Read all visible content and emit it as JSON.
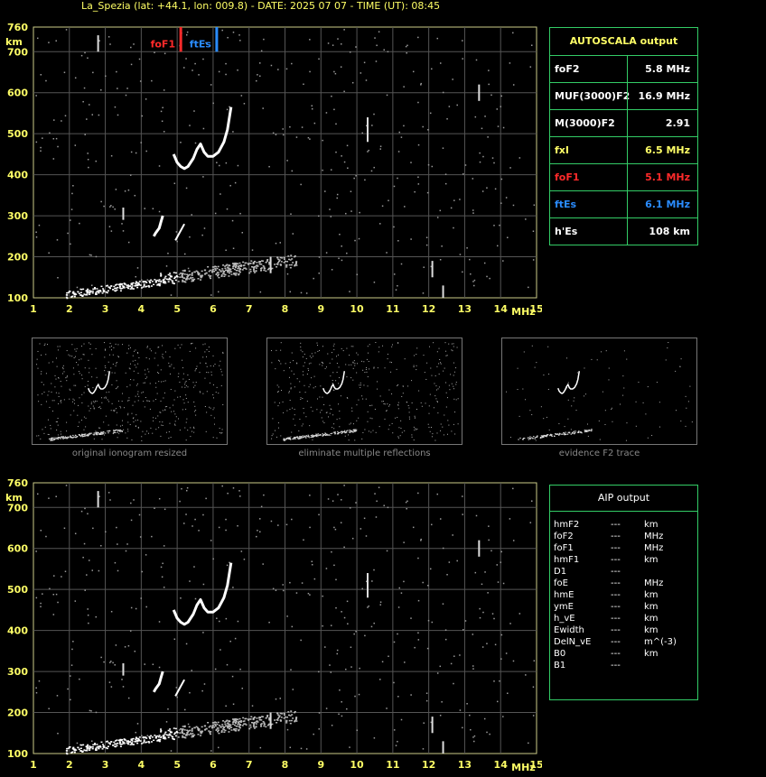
{
  "header": {
    "title": "La_Spezia (lat: +44.1, lon: 009.8) - DATE: 2025 07 07 - TIME (UT): 08:45"
  },
  "axes": {
    "y_unit": "km",
    "x_unit": "MHz",
    "y_ticks": [
      "760",
      "700",
      "600",
      "500",
      "400",
      "300",
      "200",
      "100"
    ],
    "x_ticks": [
      "1",
      "2",
      "3",
      "4",
      "5",
      "6",
      "7",
      "8",
      "9",
      "10",
      "11",
      "12",
      "13",
      "14",
      "15"
    ],
    "ylim": [
      100,
      760
    ],
    "xlim": [
      1,
      15
    ],
    "grid": true
  },
  "markers": [
    {
      "label": "foF1",
      "freq": 5.1,
      "color": "#ff2a2a"
    },
    {
      "label": "ftEs",
      "freq": 6.1,
      "color": "#2a8cff"
    }
  ],
  "autoscala": {
    "title": "AUTOSCALA output",
    "rows": [
      {
        "label": "foF2",
        "value": "5.8 MHz",
        "color": "#ffffff"
      },
      {
        "label": "MUF(3000)F2",
        "value": "16.9 MHz",
        "color": "#ffffff"
      },
      {
        "label": "M(3000)F2",
        "value": "2.91",
        "color": "#ffffff"
      },
      {
        "label": "fxI",
        "value": "6.5 MHz",
        "color": "#ffff66"
      },
      {
        "label": "foF1",
        "value": "5.1 MHz",
        "color": "#ff2a2a"
      },
      {
        "label": "ftEs",
        "value": "6.1 MHz",
        "color": "#2a8cff"
      },
      {
        "label": "h'Es",
        "value": "108   km",
        "color": "#ffffff"
      }
    ]
  },
  "thumbnails": [
    {
      "label": "original ionogram resized"
    },
    {
      "label": "eliminate multiple reflections"
    },
    {
      "label": "evidence F2 trace"
    }
  ],
  "aip": {
    "title": "AIP output",
    "rows": [
      {
        "label": "hmF2",
        "value": "---",
        "unit": "km"
      },
      {
        "label": "foF2",
        "value": "---",
        "unit": "MHz"
      },
      {
        "label": "foF1",
        "value": "---",
        "unit": "MHz"
      },
      {
        "label": "hmF1",
        "value": "---",
        "unit": "km"
      },
      {
        "label": "D1",
        "value": "---",
        "unit": ""
      },
      {
        "label": "foE",
        "value": "---",
        "unit": "MHz"
      },
      {
        "label": "hmE",
        "value": "---",
        "unit": "km"
      },
      {
        "label": "ymE",
        "value": "---",
        "unit": "km"
      },
      {
        "label": "h_vE",
        "value": "---",
        "unit": "km"
      },
      {
        "label": "Ewidth",
        "value": "---",
        "unit": "km"
      },
      {
        "label": "DelN_vE",
        "value": "---",
        "unit": "m^(-3)"
      },
      {
        "label": "B0",
        "value": "---",
        "unit": "km"
      },
      {
        "label": "B1",
        "value": "---",
        "unit": ""
      }
    ]
  },
  "chart_data": [
    {
      "type": "scatter",
      "title": "",
      "xlabel": "MHz",
      "ylabel": "km",
      "xlim": [
        1,
        15
      ],
      "ylim": [
        100,
        760
      ],
      "series": [
        {
          "name": "F2 trace ordinary",
          "points": [
            [
              4.9,
              450
            ],
            [
              5.0,
              430
            ],
            [
              5.1,
              420
            ],
            [
              5.2,
              415
            ],
            [
              5.3,
              420
            ],
            [
              5.45,
              440
            ],
            [
              5.55,
              462
            ],
            [
              5.65,
              475
            ],
            [
              5.75,
              455
            ],
            [
              5.85,
              445
            ],
            [
              6.0,
              445
            ],
            [
              6.15,
              455
            ],
            [
              6.3,
              480
            ],
            [
              6.4,
              510
            ],
            [
              6.5,
              565
            ]
          ]
        },
        {
          "name": "F1 cusp",
          "points": [
            [
              4.35,
              250
            ],
            [
              4.4,
              258
            ],
            [
              4.5,
              270
            ],
            [
              4.55,
              285
            ],
            [
              4.6,
              300
            ]
          ]
        },
        {
          "name": "E/Es trace",
          "points": [
            [
              2.0,
              105
            ],
            [
              2.5,
              110
            ],
            [
              3.0,
              118
            ],
            [
              3.5,
              125
            ],
            [
              4.0,
              135
            ],
            [
              4.5,
              145
            ],
            [
              5.0,
              150
            ],
            [
              5.5,
              155
            ],
            [
              6.0,
              158
            ],
            [
              6.5,
              160
            ],
            [
              7.0,
              160
            ],
            [
              7.5,
              158
            ],
            [
              8.0,
              157
            ]
          ]
        }
      ]
    }
  ]
}
